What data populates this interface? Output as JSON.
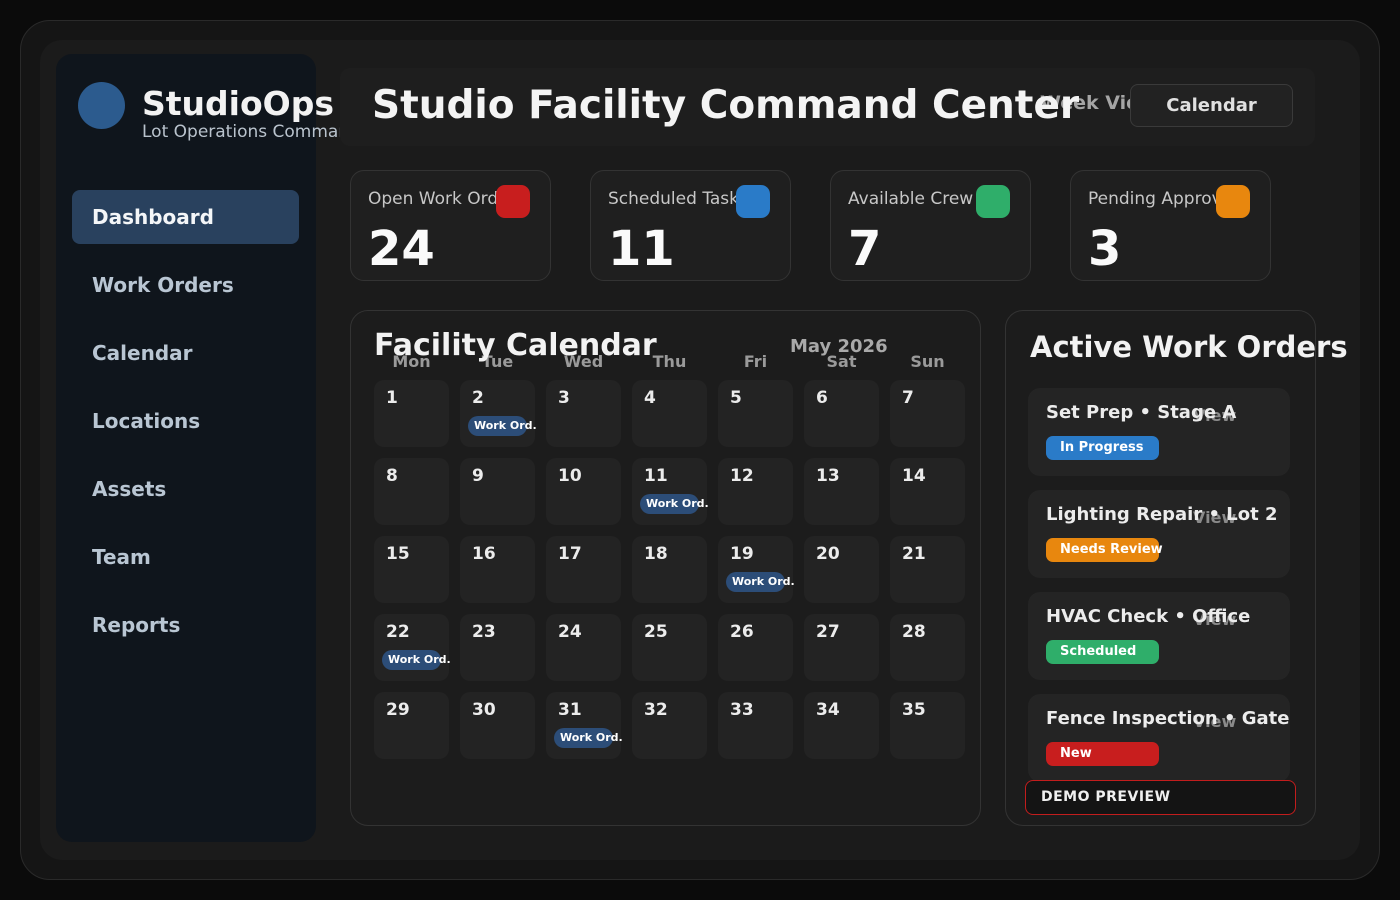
{
  "app": {
    "brand": "StudioOps",
    "subtitle": "Lot Operations Command"
  },
  "sidebar": {
    "items": [
      {
        "label": "Dashboard",
        "active": true
      },
      {
        "label": "Work Orders"
      },
      {
        "label": "Calendar"
      },
      {
        "label": "Locations"
      },
      {
        "label": "Assets"
      },
      {
        "label": "Team"
      },
      {
        "label": "Reports"
      }
    ]
  },
  "header": {
    "title": "Studio Facility Command Center",
    "view_toggle": "Week View",
    "calendar_button": "Calendar"
  },
  "stats": [
    {
      "label": "Open Work Orders",
      "value": "24",
      "color": "#c81e1e"
    },
    {
      "label": "Scheduled Tasks",
      "value": "11",
      "color": "#2a7bc8"
    },
    {
      "label": "Available Crew",
      "value": "7",
      "color": "#2fae6a"
    },
    {
      "label": "Pending Approvals",
      "value": "3",
      "color": "#e8870e"
    }
  ],
  "calendar": {
    "title": "Facility Calendar",
    "month": "May 2026",
    "weekdays": [
      "Mon",
      "Tue",
      "Wed",
      "Thu",
      "Fri",
      "Sat",
      "Sun"
    ],
    "days": [
      {
        "n": "1"
      },
      {
        "n": "2",
        "event": "Work Ord."
      },
      {
        "n": "3"
      },
      {
        "n": "4"
      },
      {
        "n": "5"
      },
      {
        "n": "6"
      },
      {
        "n": "7"
      },
      {
        "n": "8"
      },
      {
        "n": "9"
      },
      {
        "n": "10"
      },
      {
        "n": "11",
        "event": "Work Ord."
      },
      {
        "n": "12"
      },
      {
        "n": "13"
      },
      {
        "n": "14"
      },
      {
        "n": "15"
      },
      {
        "n": "16"
      },
      {
        "n": "17"
      },
      {
        "n": "18"
      },
      {
        "n": "19",
        "event": "Work Ord."
      },
      {
        "n": "20"
      },
      {
        "n": "21"
      },
      {
        "n": "22",
        "event": "Work Ord."
      },
      {
        "n": "23"
      },
      {
        "n": "24"
      },
      {
        "n": "25"
      },
      {
        "n": "26"
      },
      {
        "n": "27"
      },
      {
        "n": "28"
      },
      {
        "n": "29"
      },
      {
        "n": "30"
      },
      {
        "n": "31",
        "event": "Work Ord."
      },
      {
        "n": "32"
      },
      {
        "n": "33"
      },
      {
        "n": "34"
      },
      {
        "n": "35"
      }
    ]
  },
  "work_orders": {
    "title": "Active Work Orders",
    "view_label": "View",
    "items": [
      {
        "name": "Set Prep • Stage A",
        "status": "In Progress",
        "color": "#2a7bc8"
      },
      {
        "name": "Lighting Repair • Lot 2",
        "status": "Needs Review",
        "color": "#e8870e"
      },
      {
        "name": "HVAC Check • Office",
        "status": "Scheduled",
        "color": "#2fae6a"
      },
      {
        "name": "Fence Inspection • Gate",
        "status": "New",
        "color": "#c81e1e"
      }
    ]
  },
  "demo_label": "DEMO PREVIEW"
}
